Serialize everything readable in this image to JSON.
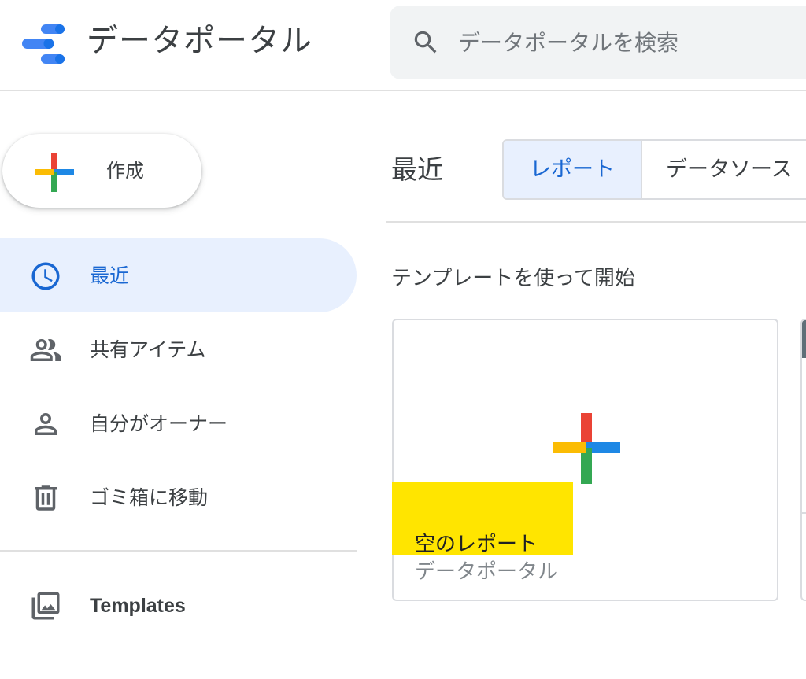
{
  "header": {
    "app_title": "データポータル",
    "logo_icon": "data-studio-logo-icon",
    "search": {
      "placeholder": "データポータルを検索",
      "value": "",
      "icon": "search-icon"
    }
  },
  "sidebar": {
    "create_label": "作成",
    "create_icon": "colored-plus-icon",
    "items": [
      {
        "label": "最近",
        "icon": "clock-icon",
        "active": true
      },
      {
        "label": "共有アイテム",
        "icon": "people-icon",
        "active": false
      },
      {
        "label": "自分がオーナー",
        "icon": "person-icon",
        "active": false
      },
      {
        "label": "ゴミ箱に移動",
        "icon": "trash-icon",
        "active": false
      }
    ],
    "templates": {
      "label": "Templates",
      "icon": "photo-library-icon"
    }
  },
  "main": {
    "heading": "最近",
    "tabs": [
      {
        "label": "レポート",
        "active": true
      },
      {
        "label": "データソース",
        "active": false
      }
    ],
    "template_section_title": "テンプレートを使って開始",
    "cards": [
      {
        "title": "空のレポート",
        "subtitle": "データポータル"
      }
    ]
  },
  "colors": {
    "accent_blue": "#1967d2",
    "active_bg": "#e8f0fe",
    "google_red": "#ea4335",
    "google_blue": "#1e88e5",
    "google_green": "#34a853",
    "google_yellow": "#fbbc04",
    "highlight_yellow": "#ffe500"
  }
}
